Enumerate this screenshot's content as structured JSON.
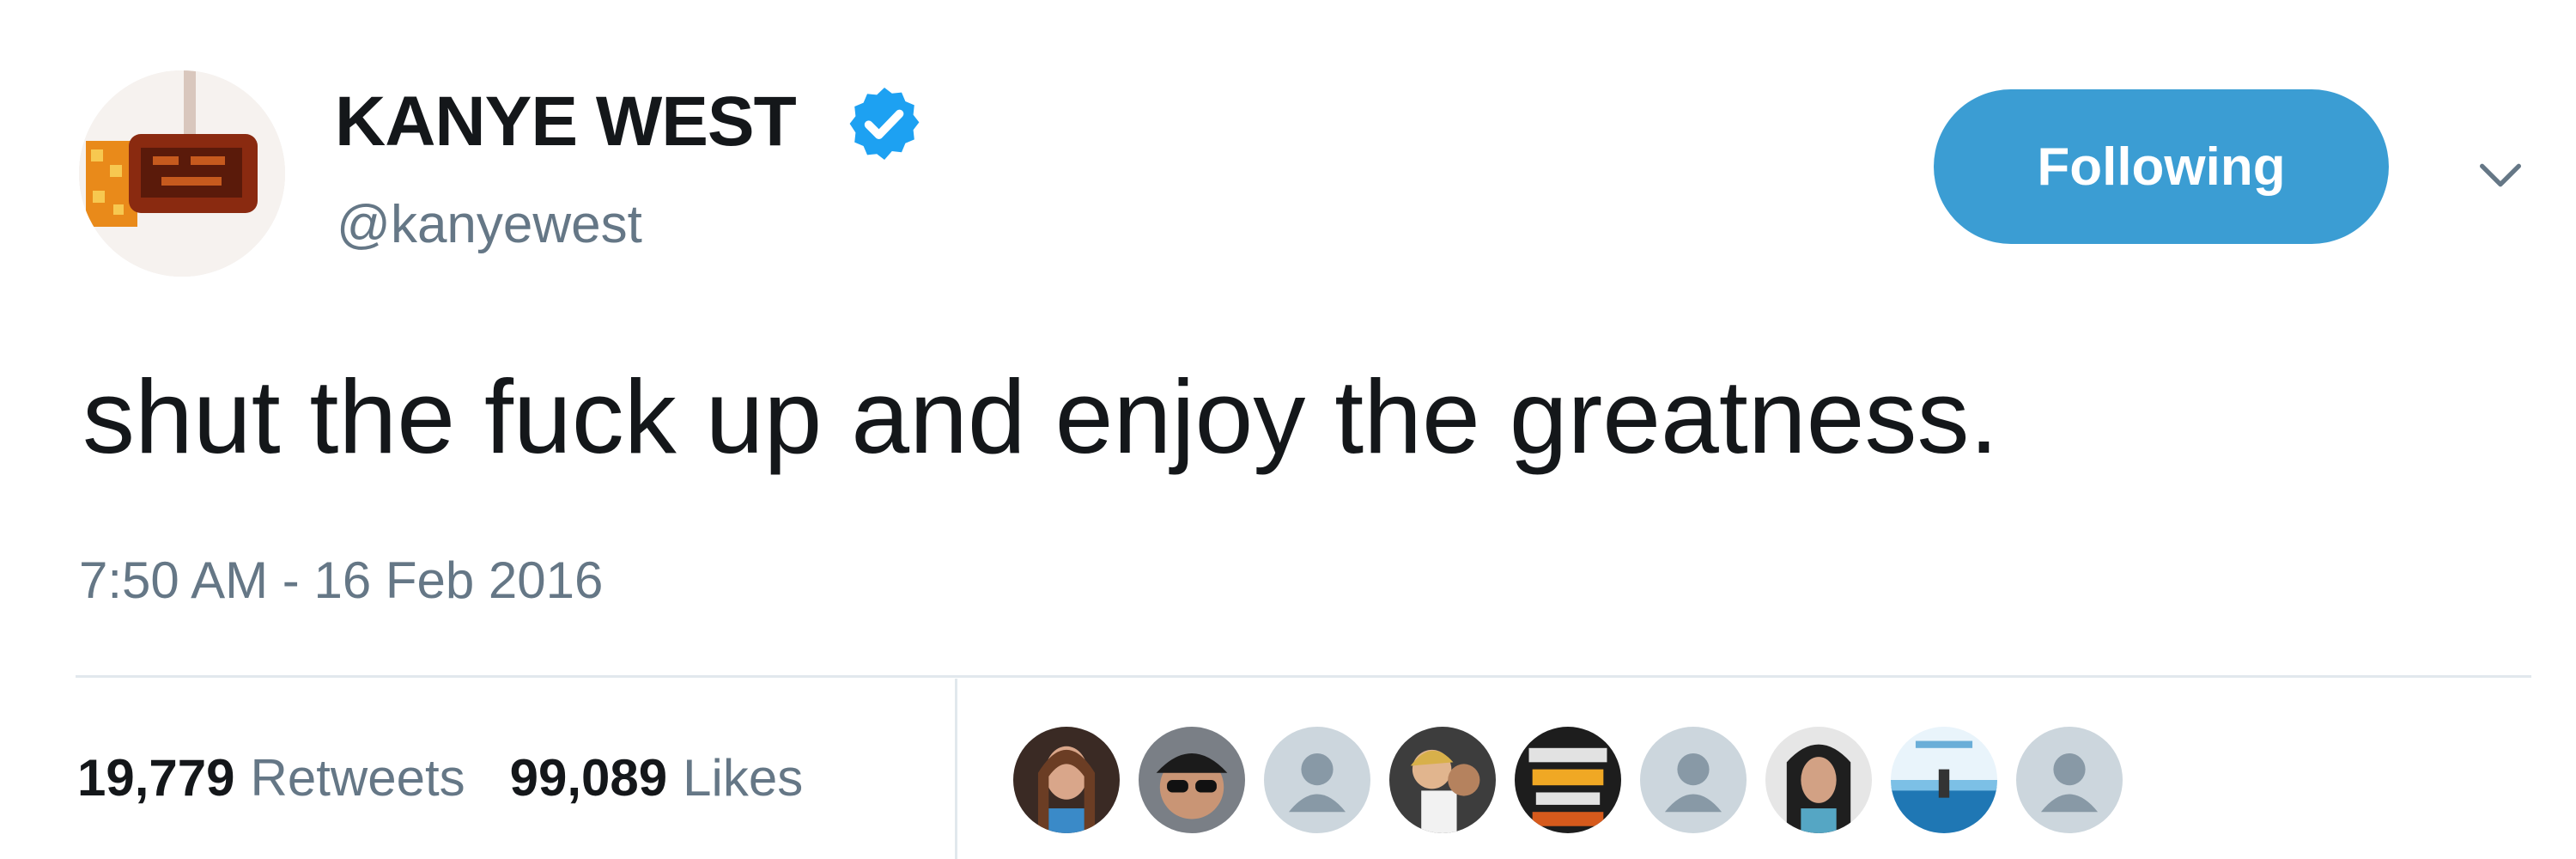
{
  "tweet": {
    "display_name": "KANYE WEST",
    "handle": "@kanyewest",
    "verified": true,
    "follow_button_label": "Following",
    "text": "shut the fuck up and enjoy the greatness.",
    "timestamp": "7:50 AM - 16 Feb 2016"
  },
  "stats": {
    "retweets_count": "19,779",
    "retweets_label": "Retweets",
    "likes_count": "99,089",
    "likes_label": "Likes"
  },
  "likers": [
    {
      "icon": "profile-photo"
    },
    {
      "icon": "profile-photo"
    },
    {
      "icon": "default-avatar-icon"
    },
    {
      "icon": "profile-photo"
    },
    {
      "icon": "profile-photo"
    },
    {
      "icon": "default-avatar-icon"
    },
    {
      "icon": "profile-photo"
    },
    {
      "icon": "profile-photo"
    },
    {
      "icon": "default-avatar-icon"
    }
  ],
  "colors": {
    "follow_button": "#3b9dd3",
    "verified_badge": "#1da1f2",
    "secondary_text": "#657786",
    "primary_text": "#14171a",
    "divider": "#e1e8ed"
  }
}
